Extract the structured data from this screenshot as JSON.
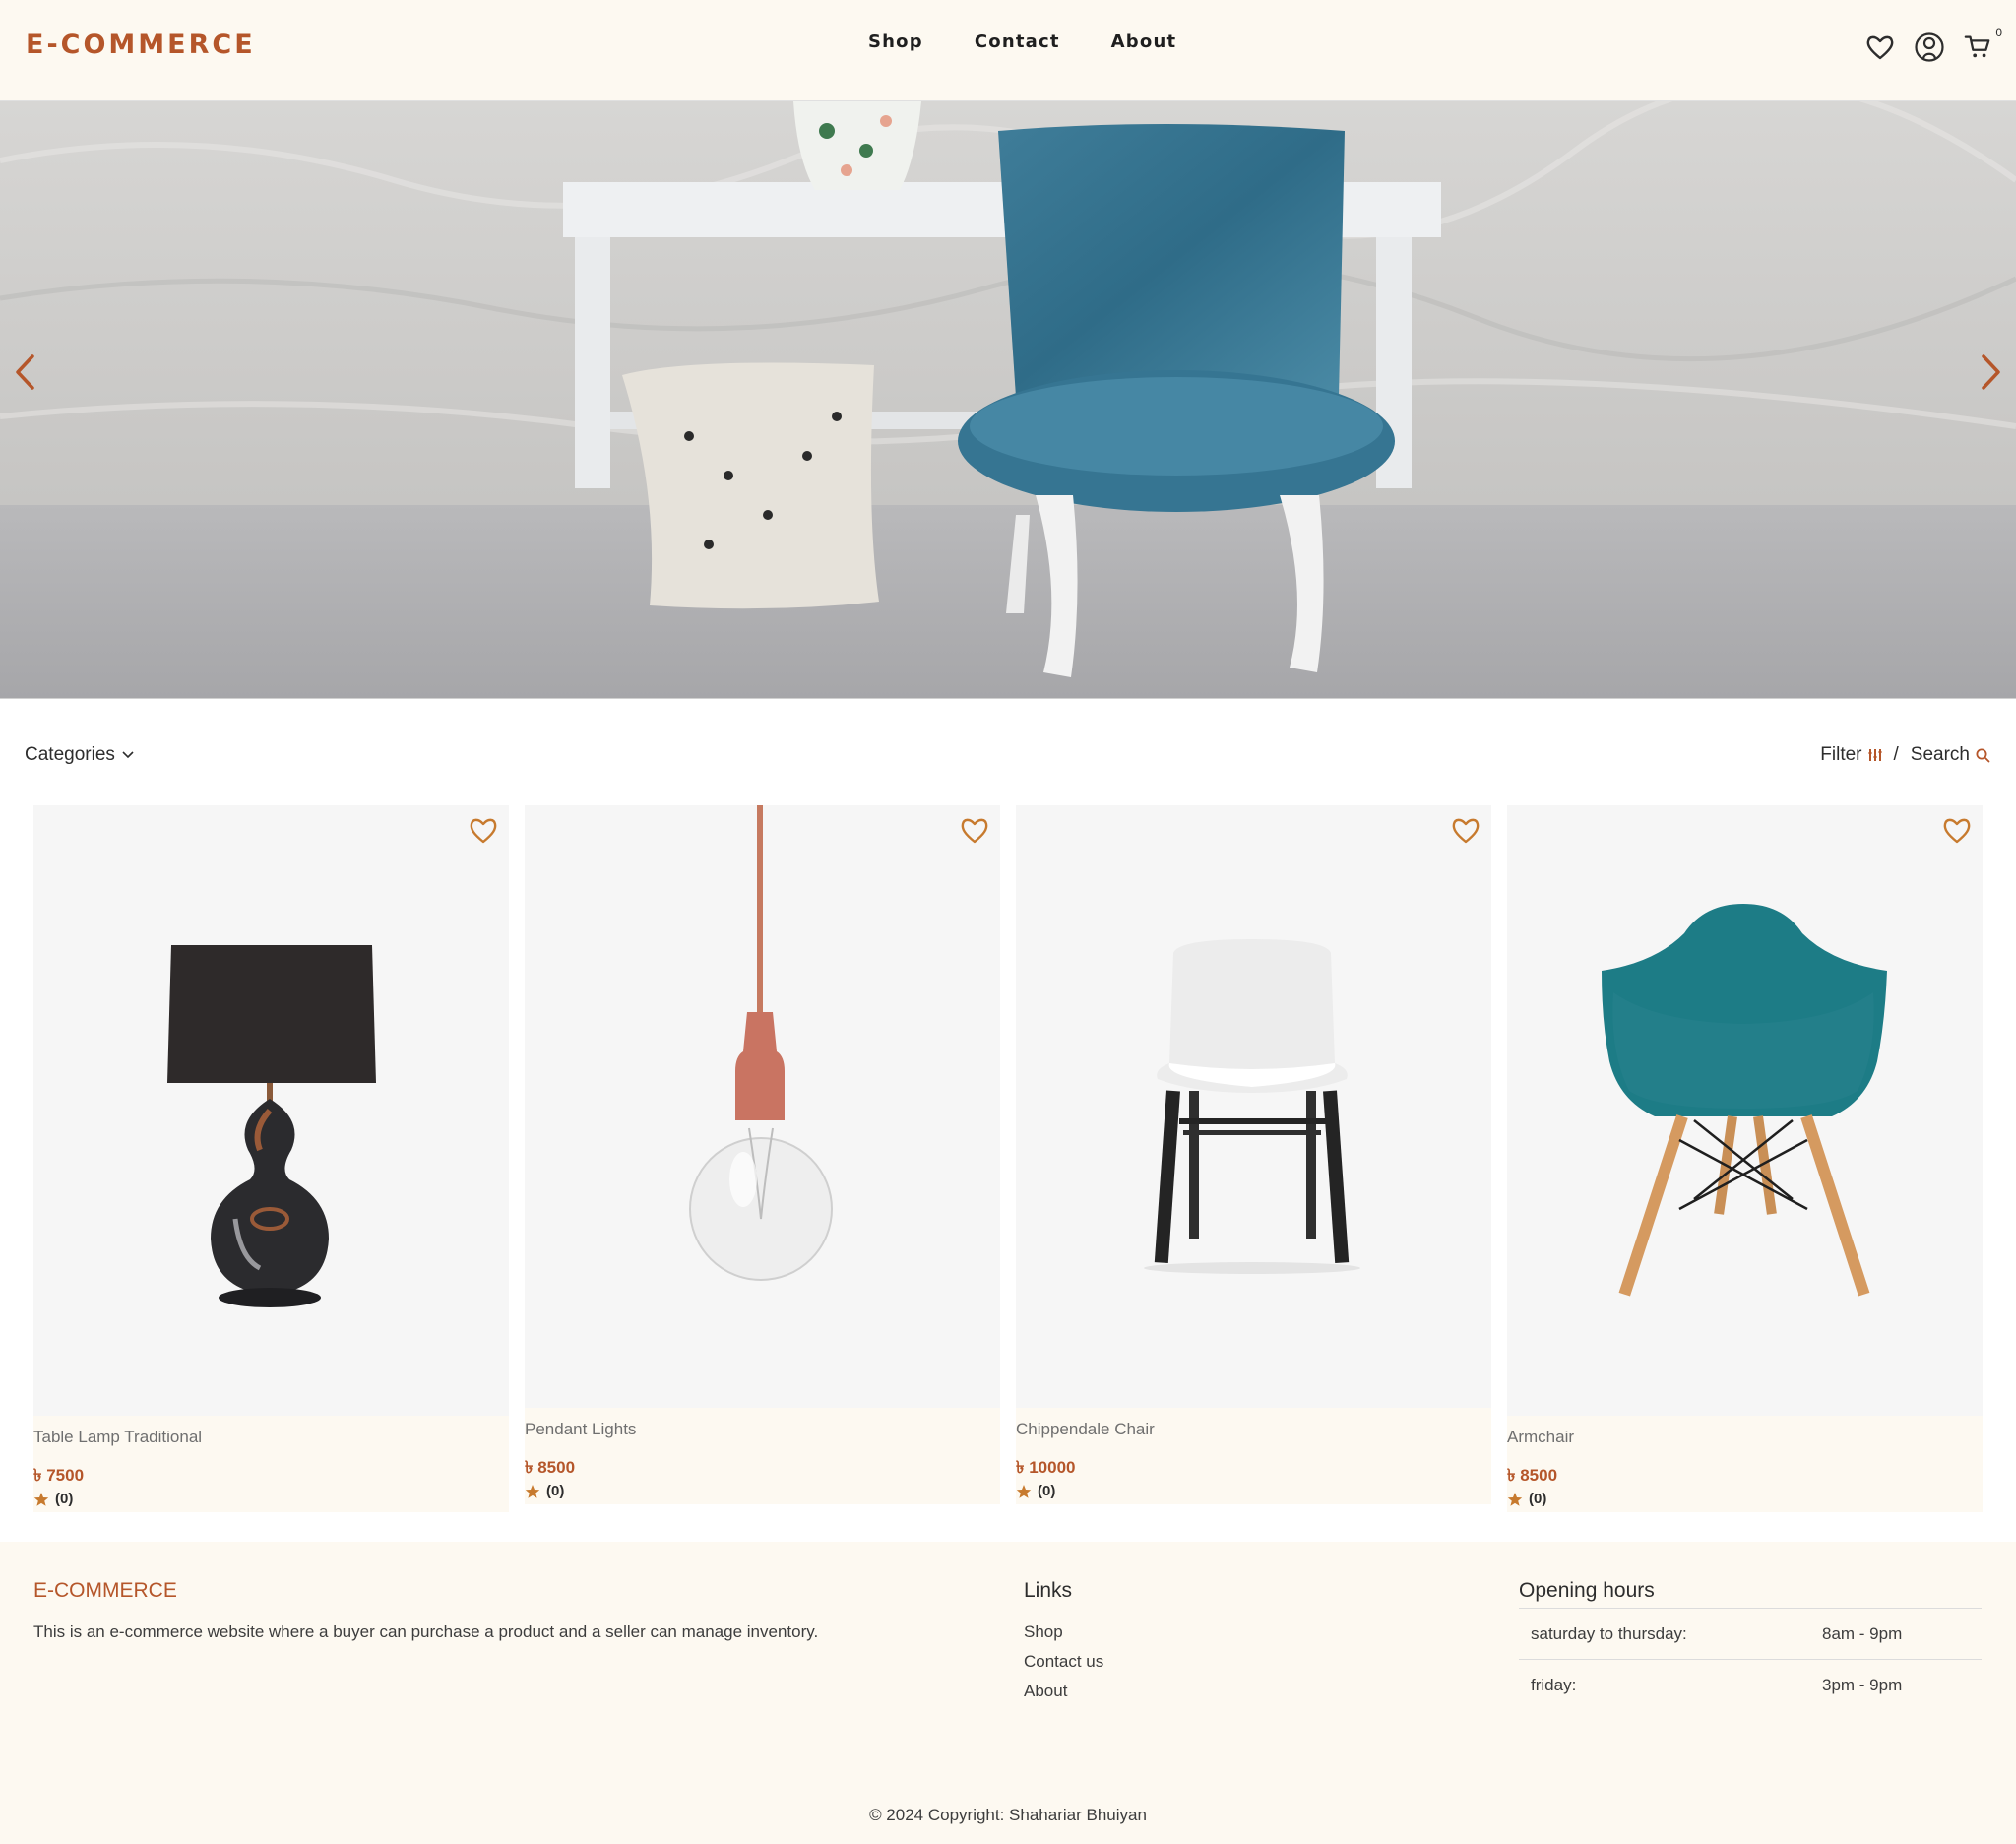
{
  "header": {
    "logo": "E-COMMERCE",
    "nav": [
      "Shop",
      "Contact",
      "About"
    ],
    "cart_count": "0",
    "icons": [
      "heart-icon",
      "user-icon",
      "cart-icon"
    ]
  },
  "hero": {
    "prev_icon": "chevron-left-icon",
    "next_icon": "chevron-right-icon"
  },
  "toolbar": {
    "categories_label": "Categories",
    "filter_label": "Filter",
    "separator": "/",
    "search_label": "Search"
  },
  "products": [
    {
      "name": "Table Lamp Traditional",
      "currency": "৳",
      "price": "7500",
      "rating": "(0)"
    },
    {
      "name": "Pendant Lights",
      "currency": "৳",
      "price": "8500",
      "rating": "(0)"
    },
    {
      "name": "Chippendale Chair",
      "currency": "৳",
      "price": "10000",
      "rating": "(0)"
    },
    {
      "name": "Armchair",
      "currency": "৳",
      "price": "8500",
      "rating": "(0)"
    }
  ],
  "footer": {
    "brand": "E-COMMERCE",
    "description": "This is an e-commerce website where a buyer can purchase a product and a seller can manage inventory.",
    "links_title": "Links",
    "links": [
      "Shop",
      "Contact us",
      "About"
    ],
    "hours_title": "Opening hours",
    "hours": [
      {
        "day": "saturday to thursday:",
        "time": "8am - 9pm"
      },
      {
        "day": "friday:",
        "time": "3pm - 9pm"
      }
    ],
    "copyright": "© 2024 Copyright:  Shahariar Bhuiyan"
  },
  "colors": {
    "accent": "#b5562a",
    "cream": "#fdf9f1",
    "card_bg": "#f6f6f6"
  }
}
